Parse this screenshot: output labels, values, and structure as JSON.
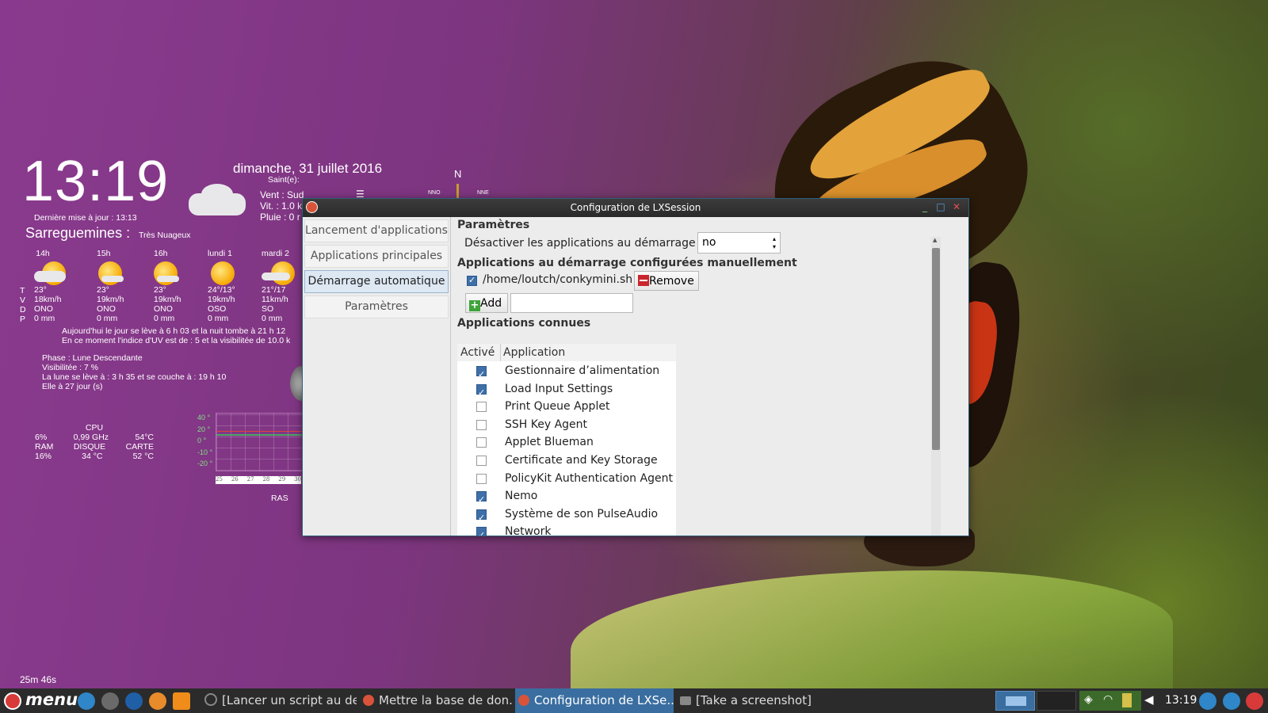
{
  "conky": {
    "time": "13:19",
    "date": "dimanche, 31 juillet 2016",
    "saint": "Saint(e):",
    "last_update": "Dernière mise à jour : 13:13",
    "city": "Sarreguemines :",
    "condition": "Très Nuageux",
    "wind": "Vent : Sud",
    "speed": "Vit. : 1.0 k",
    "rain": "Pluie : 0 r",
    "compass_n": "N",
    "compass_nno": "NNO",
    "compass_nne": "NNE",
    "forecast": [
      {
        "label": "14h",
        "t": "23°",
        "v": "18km/h",
        "d": "ONO",
        "p": "0 mm"
      },
      {
        "label": "15h",
        "t": "23°",
        "v": "19km/h",
        "d": "ONO",
        "p": "0 mm"
      },
      {
        "label": "16h",
        "t": "23°",
        "v": "19km/h",
        "d": "ONO",
        "p": "0 mm"
      },
      {
        "label": "lundi 1",
        "t": "24°/13°",
        "v": "19km/h",
        "d": "OSO",
        "p": "0 mm"
      },
      {
        "label": "mardi 2",
        "t": "21°/17",
        "v": "11km/h",
        "d": "SO",
        "p": "0 mm"
      }
    ],
    "row_labels": [
      "T",
      "V",
      "D",
      "P"
    ],
    "sun_line1": "Aujourd'hui le jour se lève à 6 h 03 et la nuit tombe à 21 h 12",
    "sun_line2": "En ce moment l'indice d'UV est de : 5 et la visibilitée de 10.0 k",
    "moon_phase": "Phase : Lune Descendante",
    "moon_visibility": "Visibilitée : 7 %",
    "moon_rise": "La lune se lève à : 3 h 35  et se couche à : 19 h 10",
    "moon_age": "Elle à 27 jour (s)",
    "sys": {
      "cpu_label": "CPU",
      "cpu_pct": "6%",
      "cpu_freq": "0,99 GHz",
      "cpu_temp": "54°C",
      "ram_label": "RAM",
      "disk_label": "DISQUE",
      "card_label": "CARTE",
      "ram_pct": "16%",
      "disk_temp": "34 °C",
      "card_temp": "52 °C"
    },
    "graph_y": [
      "40 °",
      "20 °",
      "0 °",
      "-10 °",
      "-20 °"
    ],
    "graph_x": [
      "25",
      "26",
      "27",
      "28",
      "29",
      "30"
    ],
    "ras": "RAS",
    "uptime": "25m 46s"
  },
  "window": {
    "title": "Configuration de LXSession",
    "sidebar": [
      "Lancement d'applications",
      "Applications principales",
      "Démarrage automatique",
      "Paramètres"
    ],
    "params_heading": "Paramètres",
    "disable_label": "Désactiver les applications au démarrage ?",
    "disable_value": "no",
    "manual_heading": "Applications au démarrage configurées manuellement",
    "manual_item": "/home/loutch/conkymini.sh",
    "remove_label": "Remove",
    "add_label": "Add",
    "add_input_value": "",
    "known_heading": "Applications connues",
    "col_active": "Activé",
    "col_app": "Application",
    "apps": [
      {
        "name": "Gestionnaire d’alimentation",
        "on": true
      },
      {
        "name": "Load Input Settings",
        "on": true
      },
      {
        "name": "Print Queue Applet",
        "on": false
      },
      {
        "name": "SSH Key Agent",
        "on": false
      },
      {
        "name": "Applet Blueman",
        "on": false
      },
      {
        "name": "Certificate and Key Storage",
        "on": false
      },
      {
        "name": "PolicyKit Authentication Agent",
        "on": false
      },
      {
        "name": "Nemo",
        "on": true
      },
      {
        "name": "Système de son PulseAudio",
        "on": true
      },
      {
        "name": "Network",
        "on": true
      }
    ]
  },
  "taskbar": {
    "menu_label": "menu",
    "tasks": [
      "[Lancer un script au de...",
      "Mettre la base de don...",
      "Configuration de LXSe...",
      "[Take a screenshot]"
    ],
    "clock": "13:19"
  },
  "colors": {
    "accent": "#3e6fa8",
    "titlebar": "#2f2f2f",
    "taskbar": "#2b2b2b",
    "remove_red": "#c8262c",
    "add_green": "#3fa43a"
  }
}
